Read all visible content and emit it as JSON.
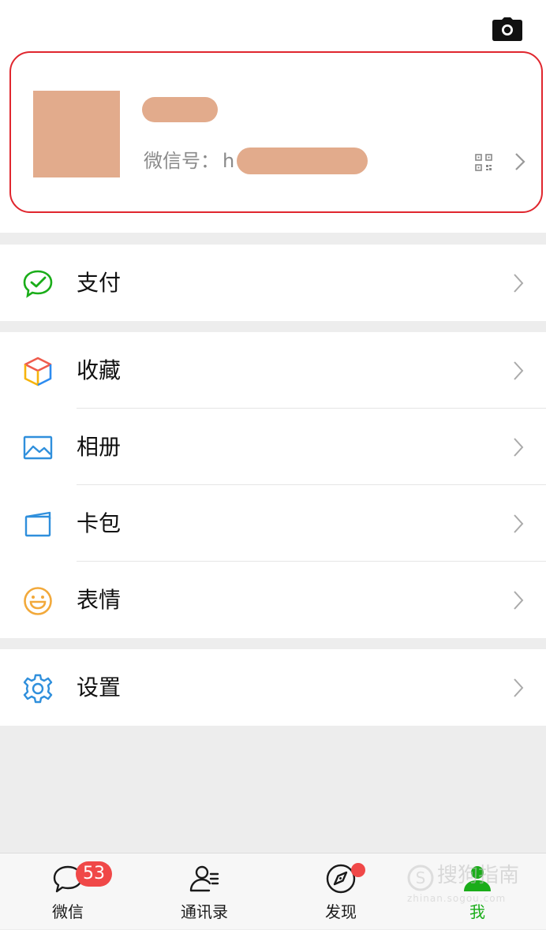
{
  "profile": {
    "wechat_id_label": "微信号：",
    "wechat_id_start": "h"
  },
  "menu_groups": [
    [
      {
        "label": "支付",
        "icon": "wallet-icon"
      }
    ],
    [
      {
        "label": "收藏",
        "icon": "favorites-cube-icon"
      },
      {
        "label": "相册",
        "icon": "album-image-icon"
      },
      {
        "label": "卡包",
        "icon": "card-pack-icon"
      },
      {
        "label": "表情",
        "icon": "smiley-icon"
      }
    ],
    [
      {
        "label": "设置",
        "icon": "gear-icon"
      }
    ]
  ],
  "tabs": [
    {
      "label": "微信",
      "icon": "chat-bubble-icon",
      "active": false
    },
    {
      "label": "通讯录",
      "icon": "contacts-icon",
      "active": false
    },
    {
      "label": "发现",
      "icon": "compass-icon",
      "active": false
    },
    {
      "label": "我",
      "icon": "me-person-icon",
      "active": true
    }
  ],
  "badges": {
    "chats_unread": "53"
  },
  "watermark": {
    "main": "搜狗指南",
    "sub": "zhinan.sogou.com"
  },
  "colors": {
    "accent": "#1aad19",
    "badge": "#f04848",
    "highlight_border": "#e0262e"
  }
}
